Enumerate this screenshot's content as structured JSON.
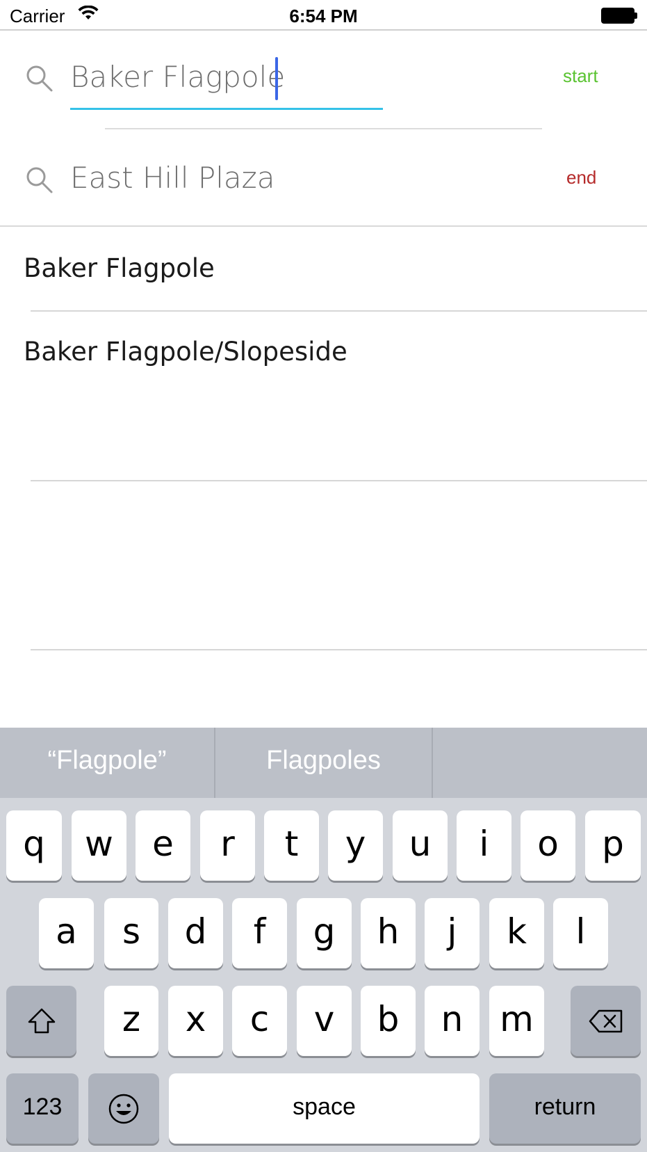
{
  "status_bar": {
    "carrier": "Carrier",
    "time": "6:54 PM",
    "wifi_icon": "wifi-icon",
    "battery_icon": "battery-icon"
  },
  "search": {
    "start": {
      "value": "Baker Flagpole",
      "action_label": "start",
      "action_color": "#5ac331",
      "icon": "search-icon"
    },
    "end": {
      "value": "East Hill Plaza",
      "action_label": "end",
      "action_color": "#b52a2a",
      "icon": "search-icon"
    },
    "accent_color": "#35c2e8"
  },
  "results": [
    {
      "label": "Baker Flagpole"
    },
    {
      "label": "Baker Flagpole/Slopeside"
    }
  ],
  "keyboard": {
    "suggestions": [
      "“Flagpole”",
      "Flagpoles",
      ""
    ],
    "row1": [
      "q",
      "w",
      "e",
      "r",
      "t",
      "y",
      "u",
      "i",
      "o",
      "p"
    ],
    "row2": [
      "a",
      "s",
      "d",
      "f",
      "g",
      "h",
      "j",
      "k",
      "l"
    ],
    "row3": [
      "z",
      "x",
      "c",
      "v",
      "b",
      "n",
      "m"
    ],
    "shift_icon": "shift-icon",
    "delete_icon": "delete-icon",
    "numbers_label": "123",
    "emoji_icon": "emoji-icon",
    "space_label": "space",
    "return_label": "return"
  }
}
